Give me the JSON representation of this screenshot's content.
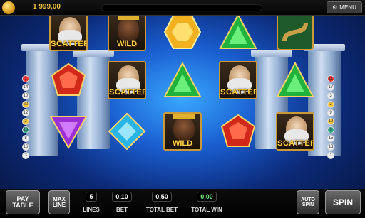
{
  "balance": "1 999,00",
  "menu_label": "MENU",
  "reels": [
    [
      "scatter",
      "ruby",
      "purple"
    ],
    [
      "wild",
      "scatter",
      "diamond"
    ],
    [
      "topaz",
      "emerald",
      "wild"
    ],
    [
      "emerald",
      "scatter",
      "ruby"
    ],
    [
      "serpent",
      "emerald",
      "scatter"
    ]
  ],
  "symbol_labels": {
    "wild": "WILD",
    "scatter": "SCATTER"
  },
  "left_lines": [
    "1",
    "14",
    "10",
    "20",
    "12",
    "2",
    "18",
    "8",
    "16",
    "3"
  ],
  "right_lines": [
    "11",
    "17",
    "3",
    "2",
    "9",
    "19",
    "6",
    "15",
    "13",
    "1"
  ],
  "buttons": {
    "paytable": "PAY TABLE",
    "maxline": "MAX LINE",
    "autospin": "AUTO SPIN",
    "spin": "SPIN"
  },
  "lines_value": "5",
  "lines_caption": "LINES",
  "bet_value": "0,10",
  "bet_caption": "BET",
  "total_bet_value": "0,50",
  "total_bet_caption": "TOTAL BET",
  "total_win_value": "0,00",
  "total_win_caption": "TOTAL WIN",
  "colors": {
    "gold": "#f5c542",
    "ruby": "#d2281a",
    "emerald": "#1fb23c",
    "sapphire": "#28b4e6",
    "amethyst": "#9a2fd6",
    "topaz": "#f0b020"
  }
}
